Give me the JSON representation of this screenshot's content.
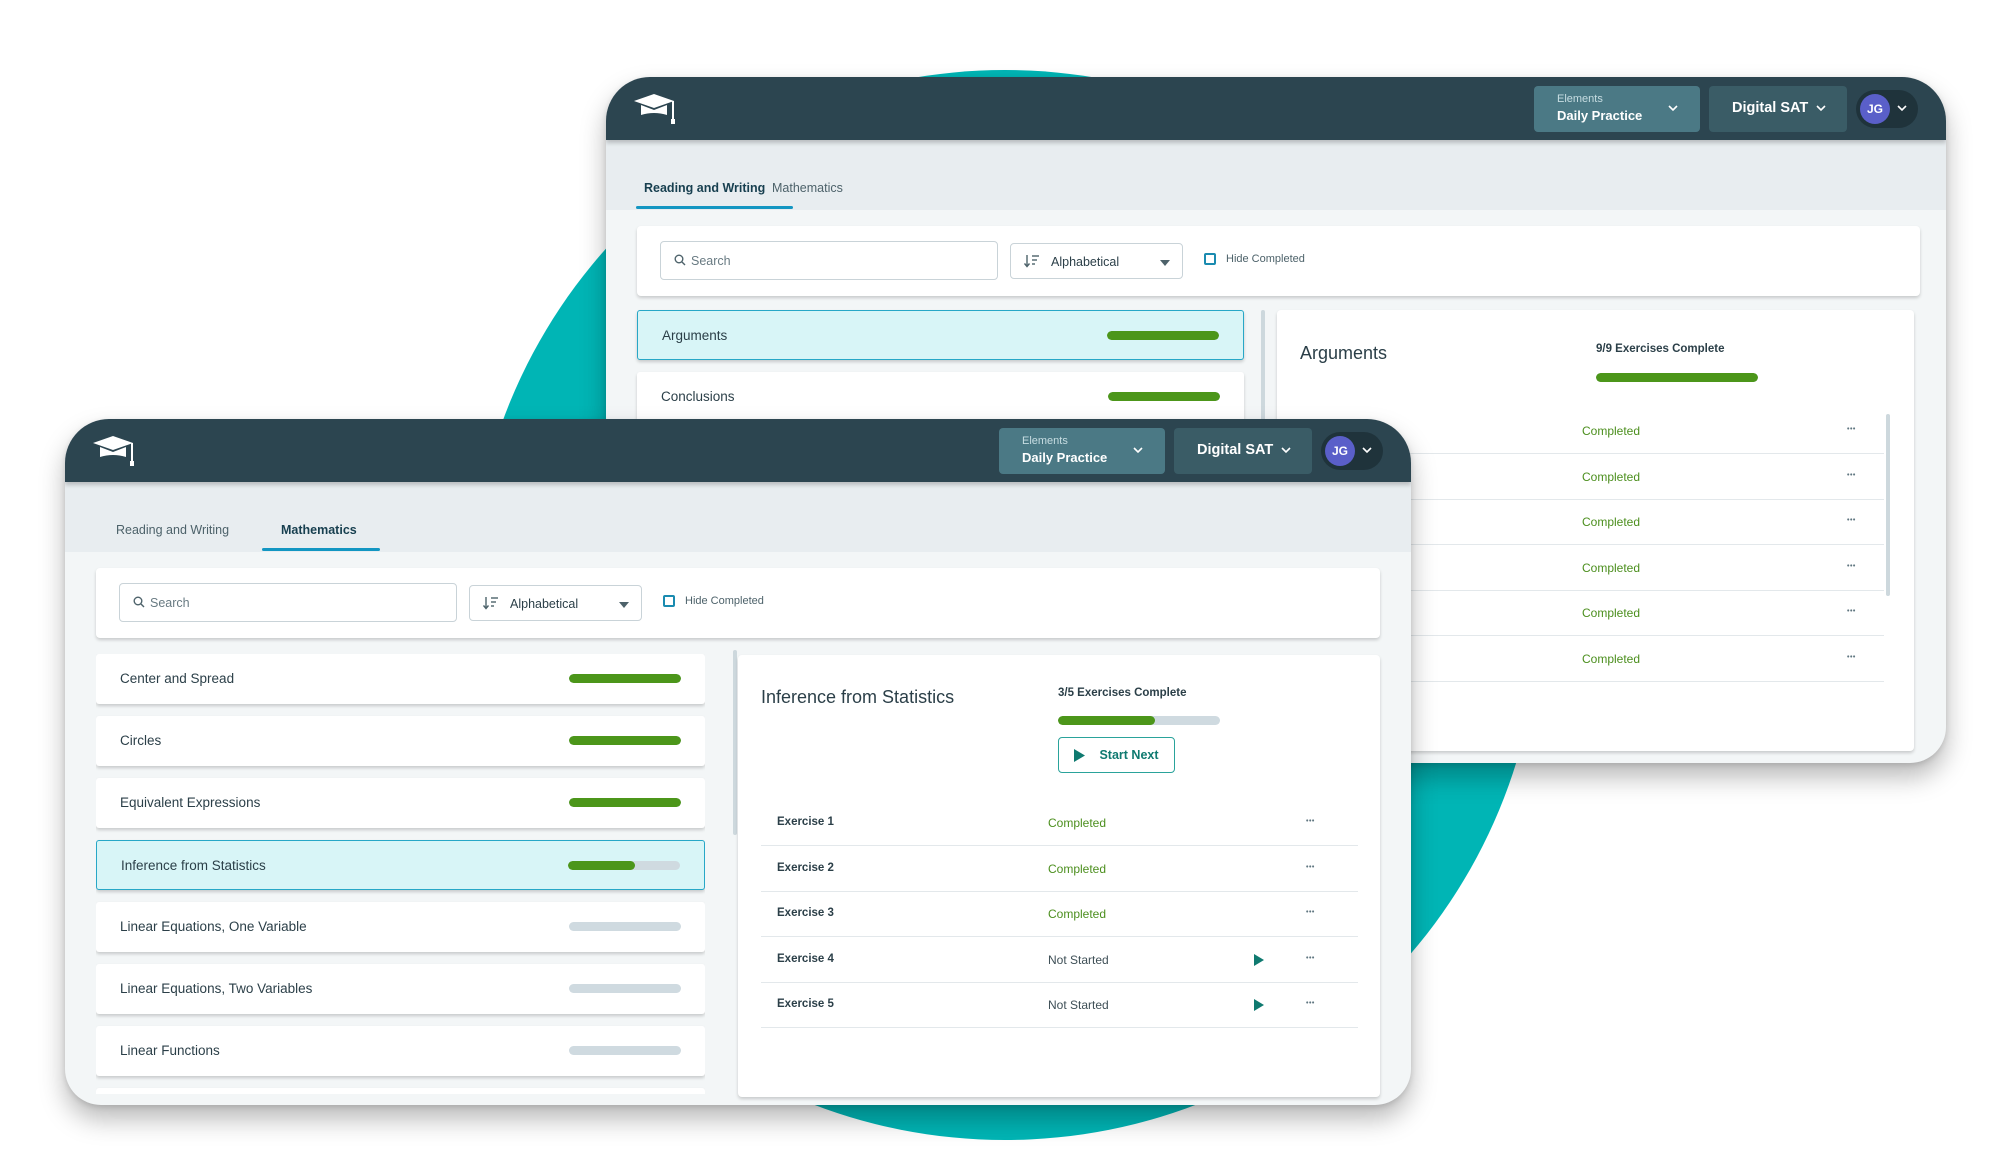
{
  "colors": {
    "accent_teal": "#00b5b5",
    "header": "#2c4550",
    "progress_green": "#4c961a",
    "completed_text": "#4c8f1e",
    "avatar": "#5a5fc9",
    "selected_row": "#d8f5f7"
  },
  "back_window": {
    "header": {
      "logo_icon": "graduation-cap-icon",
      "program_dropdown": {
        "caption": "Elements",
        "value": "Daily Practice"
      },
      "test_dropdown": {
        "value": "Digital SAT"
      },
      "user": {
        "initials": "JG"
      }
    },
    "tabs": [
      {
        "label": "Reading and Writing",
        "active": true
      },
      {
        "label": "Mathematics",
        "active": false
      }
    ],
    "filters": {
      "search_placeholder": "Search",
      "sort_value": "Alphabetical",
      "hide_completed_label": "Hide Completed",
      "hide_completed_checked": false
    },
    "skills": [
      {
        "name": "Arguments",
        "progress": 1.0,
        "selected": true
      },
      {
        "name": "Conclusions",
        "progress": 1.0,
        "selected": false
      }
    ],
    "detail": {
      "title": "Arguments",
      "summary": "9/9 Exercises Complete",
      "progress": 1.0,
      "rows": [
        {
          "status": "Completed"
        },
        {
          "status": "Completed"
        },
        {
          "status": "Completed"
        },
        {
          "status": "Completed"
        },
        {
          "status": "Completed"
        },
        {
          "status": "Completed"
        }
      ]
    }
  },
  "front_window": {
    "header": {
      "logo_icon": "graduation-cap-icon",
      "program_dropdown": {
        "caption": "Elements",
        "value": "Daily Practice"
      },
      "test_dropdown": {
        "value": "Digital SAT"
      },
      "user": {
        "initials": "JG"
      }
    },
    "tabs": [
      {
        "label": "Reading and Writing",
        "active": false
      },
      {
        "label": "Mathematics",
        "active": true
      }
    ],
    "filters": {
      "search_placeholder": "Search",
      "sort_value": "Alphabetical",
      "hide_completed_label": "Hide Completed",
      "hide_completed_checked": false
    },
    "skills": [
      {
        "name": "Center and Spread",
        "progress": 1.0,
        "selected": false
      },
      {
        "name": "Circles",
        "progress": 1.0,
        "selected": false
      },
      {
        "name": "Equivalent Expressions",
        "progress": 1.0,
        "selected": false
      },
      {
        "name": "Inference from Statistics",
        "progress": 0.6,
        "selected": true
      },
      {
        "name": "Linear Equations, One Variable",
        "progress": 0.0,
        "selected": false
      },
      {
        "name": "Linear Equations, Two Variables",
        "progress": 0.0,
        "selected": false
      },
      {
        "name": "Linear Functions",
        "progress": 0.0,
        "selected": false
      }
    ],
    "detail": {
      "title": "Inference from Statistics",
      "summary": "3/5 Exercises Complete",
      "progress": 0.6,
      "start_next_label": "Start Next",
      "exercises": [
        {
          "name": "Exercise 1",
          "status": "Completed",
          "completed": true
        },
        {
          "name": "Exercise 2",
          "status": "Completed",
          "completed": true
        },
        {
          "name": "Exercise 3",
          "status": "Completed",
          "completed": true
        },
        {
          "name": "Exercise 4",
          "status": "Not Started",
          "completed": false
        },
        {
          "name": "Exercise 5",
          "status": "Not Started",
          "completed": false
        }
      ]
    }
  }
}
